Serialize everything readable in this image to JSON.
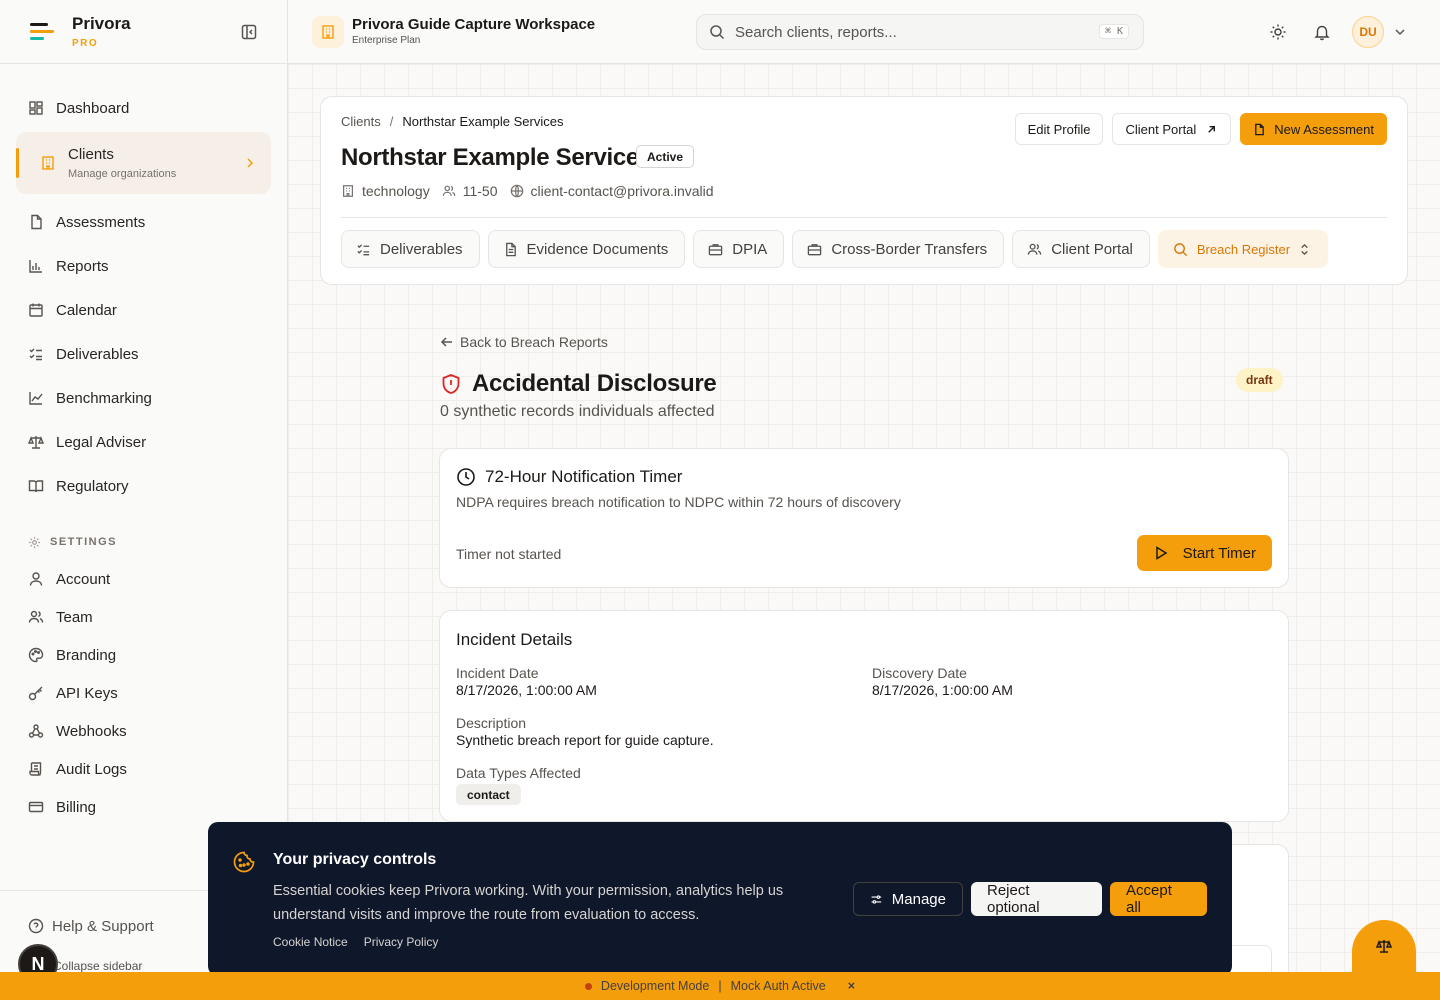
{
  "brand": {
    "name": "Privora",
    "tier": "PRO"
  },
  "sidebar": {
    "nav": [
      {
        "label": "Dashboard",
        "icon": "dashboard-icon"
      },
      {
        "label": "Clients",
        "sub": "Manage organizations",
        "icon": "building-icon",
        "active": true
      },
      {
        "label": "Assessments",
        "icon": "document-icon"
      },
      {
        "label": "Reports",
        "icon": "bar-chart-icon"
      },
      {
        "label": "Calendar",
        "icon": "calendar-icon"
      },
      {
        "label": "Deliverables",
        "icon": "checklist-icon"
      },
      {
        "label": "Benchmarking",
        "icon": "line-chart-icon"
      },
      {
        "label": "Legal Adviser",
        "icon": "scale-icon"
      },
      {
        "label": "Regulatory",
        "icon": "book-icon"
      }
    ],
    "settings_heading": "SETTINGS",
    "settings": [
      {
        "label": "Account",
        "icon": "user-icon"
      },
      {
        "label": "Team",
        "icon": "users-icon"
      },
      {
        "label": "Branding",
        "icon": "palette-icon"
      },
      {
        "label": "API Keys",
        "icon": "key-icon"
      },
      {
        "label": "Webhooks",
        "icon": "webhook-icon"
      },
      {
        "label": "Audit Logs",
        "icon": "scroll-icon"
      },
      {
        "label": "Billing",
        "icon": "credit-card-icon"
      }
    ],
    "help": "Help & Support",
    "collapse": "Collapse sidebar",
    "n_badge": "N"
  },
  "header": {
    "workspace_title": "Privora Guide Capture Workspace",
    "workspace_plan": "Enterprise Plan",
    "search_placeholder": "Search clients, reports...",
    "search_shortcut": "⌘ K",
    "avatar_initials": "DU"
  },
  "client": {
    "breadcrumb_root": "Clients",
    "breadcrumb_sep": "/",
    "breadcrumb_current": "Northstar Example Services",
    "name": "Northstar Example Services",
    "status": "Active",
    "industry": "technology",
    "size": "11-50",
    "email": "client-contact@privora.invalid",
    "buttons": {
      "edit": "Edit Profile",
      "portal": "Client Portal",
      "new": "New Assessment"
    },
    "tabs": [
      {
        "label": "Deliverables",
        "icon": "checklist-icon"
      },
      {
        "label": "Evidence Documents",
        "icon": "document-icon"
      },
      {
        "label": "DPIA",
        "icon": "briefcase-icon"
      },
      {
        "label": "Cross-Border Transfers",
        "icon": "briefcase-icon"
      },
      {
        "label": "Client Portal",
        "icon": "users-icon"
      },
      {
        "label": "Breach Register",
        "icon": "search-icon",
        "active": true
      }
    ]
  },
  "breach": {
    "back": "Back to Breach Reports",
    "title": "Accidental Disclosure",
    "subtitle": "0 synthetic records individuals affected",
    "status": "draft",
    "timer": {
      "title": "72-Hour Notification Timer",
      "description": "NDPA requires breach notification to NDPC within 72 hours of discovery",
      "status": "Timer not started",
      "button": "Start Timer"
    },
    "incident": {
      "title": "Incident Details",
      "incident_date_label": "Incident Date",
      "incident_date": "8/17/2026, 1:00:00 AM",
      "discovery_date_label": "Discovery Date",
      "discovery_date": "8/17/2026, 1:00:00 AM",
      "description_label": "Description",
      "description": "Synthetic breach report for guide capture.",
      "data_types_label": "Data Types Affected",
      "data_types": [
        "contact"
      ]
    }
  },
  "cookie": {
    "title": "Your privacy controls",
    "text": "Essential cookies keep Privora working. With your permission, analytics help us understand visits and improve the route from evaluation to access.",
    "links": [
      "Cookie Notice",
      "Privacy Policy"
    ],
    "manage": "Manage",
    "reject": "Reject optional",
    "accept": "Accept all"
  },
  "devbar": {
    "mode": "Development Mode",
    "sep": "|",
    "auth": "Mock Auth Active",
    "close": "×"
  },
  "colors": {
    "accent": "#f59e0b",
    "danger": "#dc2626",
    "banner": "#0f172a"
  }
}
